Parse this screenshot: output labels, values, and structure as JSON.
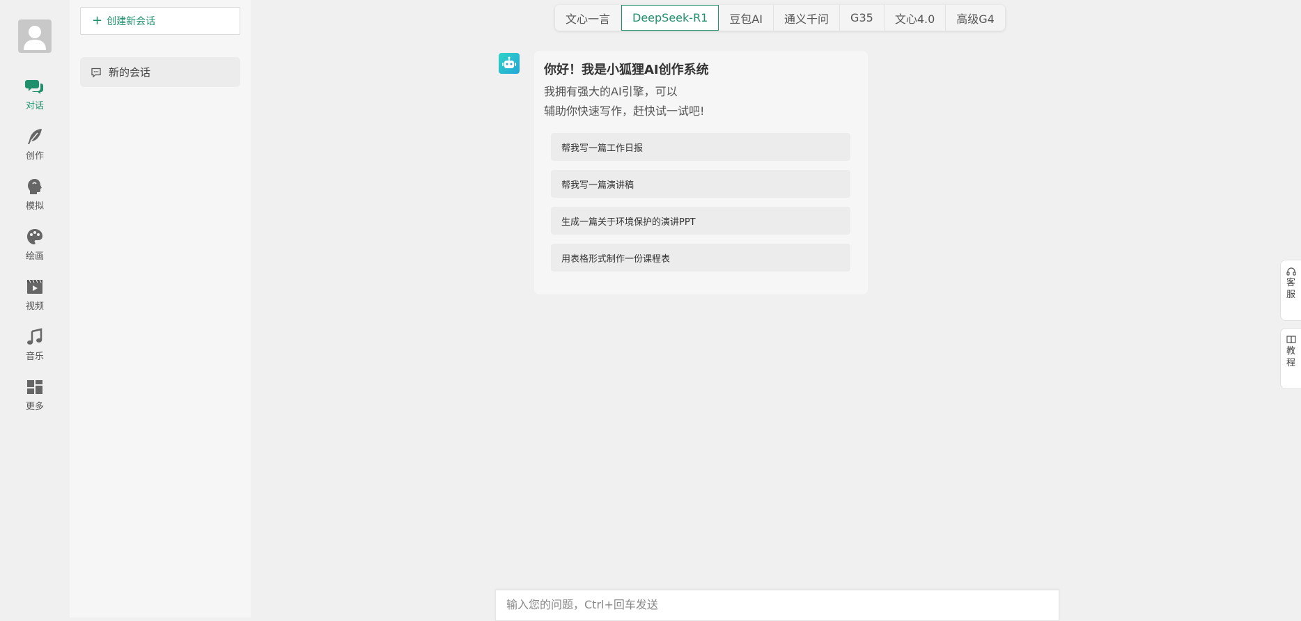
{
  "colors": {
    "accent": "#1f8f6c",
    "rail_icon": "#666666"
  },
  "rail": {
    "items": [
      {
        "label": "对话",
        "icon": "chat-bubbles-icon",
        "active": true
      },
      {
        "label": "创作",
        "icon": "feather-icon"
      },
      {
        "label": "模拟",
        "icon": "head-profile-icon"
      },
      {
        "label": "绘画",
        "icon": "palette-icon"
      },
      {
        "label": "视频",
        "icon": "video-play-icon"
      },
      {
        "label": "音乐",
        "icon": "music-note-icon"
      },
      {
        "label": "更多",
        "icon": "grid-layout-icon"
      }
    ]
  },
  "sidebar": {
    "new_button": "创建新会话",
    "conversations": [
      {
        "label": "新的会话"
      }
    ]
  },
  "tabs": [
    {
      "label": "文心一言"
    },
    {
      "label": "DeepSeek-R1",
      "active": true
    },
    {
      "label": "豆包AI"
    },
    {
      "label": "通义千问"
    },
    {
      "label": "G35"
    },
    {
      "label": "文心4.0"
    },
    {
      "label": "高级G4"
    }
  ],
  "greeting": {
    "title": "你好！我是小狐狸AI创作系统",
    "line1": "我拥有强大的AI引擎，可以",
    "line2": "辅助你快速写作，赶快试一试吧!"
  },
  "suggestions": [
    "帮我写一篇工作日报",
    "帮我写一篇演讲稿",
    "生成一篇关于环境保护的演讲PPT",
    "用表格形式制作一份课程表"
  ],
  "side_float": {
    "service": [
      "客",
      "服"
    ],
    "tutorial": [
      "教",
      "程"
    ]
  },
  "input": {
    "placeholder": "输入您的问题，Ctrl+回车发送",
    "value": ""
  }
}
